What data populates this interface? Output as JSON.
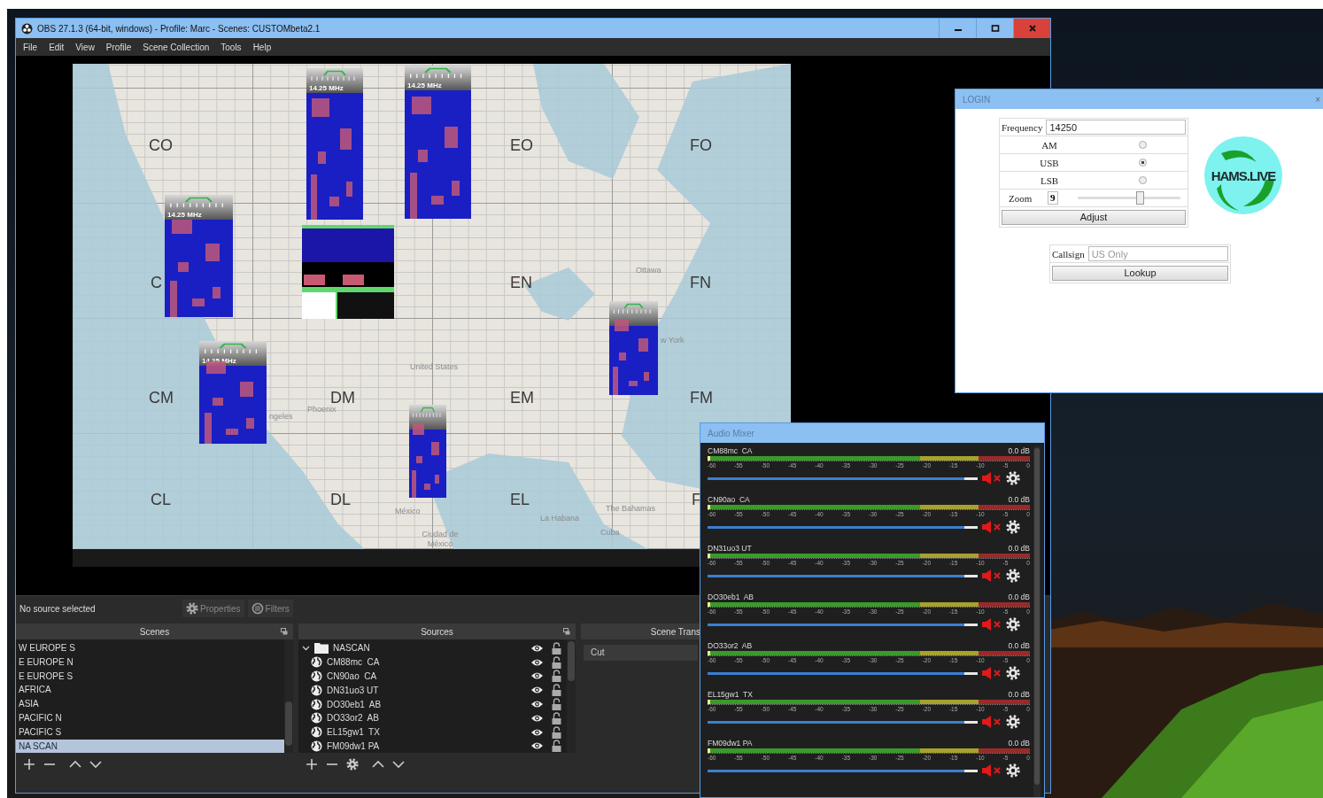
{
  "obs_window": {
    "title": "OBS 27.1.3 (64-bit, windows) - Profile: Marc - Scenes: CUSTOMbeta2.1",
    "menu": [
      "File",
      "Edit",
      "View",
      "Profile",
      "Scene Collection",
      "Tools",
      "Help"
    ]
  },
  "preview": {
    "grid_labels": [
      "CO",
      "EO",
      "FO",
      "C",
      "EN",
      "FN",
      "CM",
      "DM",
      "EM",
      "FM",
      "CL",
      "DL",
      "EL",
      "F"
    ],
    "place_names": [
      "Ottawa",
      "United States",
      "Phoenix",
      "ngeles",
      "w York",
      "México",
      "La Habana",
      "The Bahamas",
      "Cuba",
      "Ciudad de México"
    ],
    "waterfalls": [
      {
        "kind": "waterfall",
        "label": "14.25 MHz"
      },
      {
        "kind": "waterfall",
        "label": "14.25 MHz"
      },
      {
        "kind": "waterfall",
        "label": "14.25 MHz"
      },
      {
        "kind": "panel"
      },
      {
        "kind": "waterfall",
        "label": "14.25 MHz"
      },
      {
        "kind": "waterfall"
      },
      {
        "kind": "waterfall"
      }
    ]
  },
  "source_toolbar": {
    "status": "No source selected",
    "buttons": [
      "Properties",
      "Filters"
    ]
  },
  "scenes": {
    "title": "Scenes",
    "items": [
      {
        "label": "W EUROPE S",
        "selected": false
      },
      {
        "label": "E EUROPE N",
        "selected": false
      },
      {
        "label": "E EUROPE S",
        "selected": false
      },
      {
        "label": "AFRICA",
        "selected": false
      },
      {
        "label": "ASIA",
        "selected": false
      },
      {
        "label": "PACIFIC N",
        "selected": false
      },
      {
        "label": "PACIFIC S",
        "selected": false
      },
      {
        "label": "NA SCAN",
        "selected": true
      }
    ]
  },
  "sources": {
    "title": "Sources",
    "items": [
      {
        "label": "NASCAN",
        "kind": "folder",
        "expanded": true,
        "visible": true,
        "locked": false,
        "children": [
          {
            "label": "CM88mc  CA",
            "kind": "browser",
            "visible": true,
            "locked": false
          },
          {
            "label": "CN90ao  CA",
            "kind": "browser",
            "visible": true,
            "locked": false
          },
          {
            "label": "DN31uo3 UT",
            "kind": "browser",
            "visible": true,
            "locked": false
          },
          {
            "label": "DO30eb1  AB",
            "kind": "browser",
            "visible": true,
            "locked": false
          },
          {
            "label": "DO33or2  AB",
            "kind": "browser",
            "visible": true,
            "locked": false
          },
          {
            "label": "EL15gw1  TX",
            "kind": "browser",
            "visible": true,
            "locked": false
          },
          {
            "label": "FM09dw1 PA",
            "kind": "browser",
            "visible": true,
            "locked": false
          }
        ]
      }
    ]
  },
  "transitions": {
    "title": "Scene Trans",
    "value": "Cut"
  },
  "audio_mixer": {
    "title": "Audio Mixer",
    "channels": [
      {
        "name": "CM88mc  CA",
        "reading": "0.0 dB",
        "scale": [
          "-60",
          "-55",
          "-50",
          "-45",
          "-40",
          "-35",
          "-30",
          "-25",
          "-20",
          "-15",
          "-10",
          "-5",
          "0"
        ],
        "level": 0.95,
        "muted": true
      },
      {
        "name": "CN90ao  CA",
        "reading": "0.0 dB",
        "scale": [
          "-60",
          "-55",
          "-50",
          "-45",
          "-40",
          "-35",
          "-30",
          "-25",
          "-20",
          "-15",
          "-10",
          "-5",
          "0"
        ],
        "level": 0.95,
        "muted": true
      },
      {
        "name": "DN31uo3 UT",
        "reading": "0.0 dB",
        "scale": [
          "-60",
          "-55",
          "-50",
          "-45",
          "-40",
          "-35",
          "-30",
          "-25",
          "-20",
          "-15",
          "-10",
          "-5",
          "0"
        ],
        "level": 0.95,
        "muted": true
      },
      {
        "name": "DO30eb1  AB",
        "reading": "0.0 dB",
        "scale": [
          "-60",
          "-55",
          "-50",
          "-45",
          "-40",
          "-35",
          "-30",
          "-25",
          "-20",
          "-15",
          "-10",
          "-5",
          "0"
        ],
        "level": 0.95,
        "muted": true
      },
      {
        "name": "DO33or2  AB",
        "reading": "0.0 dB",
        "scale": [
          "-60",
          "-55",
          "-50",
          "-45",
          "-40",
          "-35",
          "-30",
          "-25",
          "-20",
          "-15",
          "-10",
          "-5",
          "0"
        ],
        "level": 0.95,
        "muted": true
      },
      {
        "name": "EL15gw1  TX",
        "reading": "0.0 dB",
        "scale": [
          "-60",
          "-55",
          "-50",
          "-45",
          "-40",
          "-35",
          "-30",
          "-25",
          "-20",
          "-15",
          "-10",
          "-5",
          "0"
        ],
        "level": 0.95,
        "muted": true
      },
      {
        "name": "FM09dw1 PA",
        "reading": "0.0 dB",
        "scale": [
          "-60",
          "-55",
          "-50",
          "-45",
          "-40",
          "-35",
          "-30",
          "-25",
          "-20",
          "-15",
          "-10",
          "-5",
          "0"
        ],
        "level": 0.95,
        "muted": true
      }
    ]
  },
  "login": {
    "title": "LOGIN",
    "close": "×",
    "frequency": {
      "label": "Frequency",
      "value": "14250"
    },
    "modes": [
      {
        "label": "AM",
        "selected": false
      },
      {
        "label": "USB",
        "selected": true
      },
      {
        "label": "LSB",
        "selected": false
      }
    ],
    "zoom": {
      "label": "Zoom",
      "value": "9",
      "level": 0.62
    },
    "adjust": "Adjust",
    "callsign": {
      "label": "Callsign",
      "placeholder": "US Only"
    },
    "lookup": "Lookup",
    "logo": "HAMS.LIVE"
  }
}
